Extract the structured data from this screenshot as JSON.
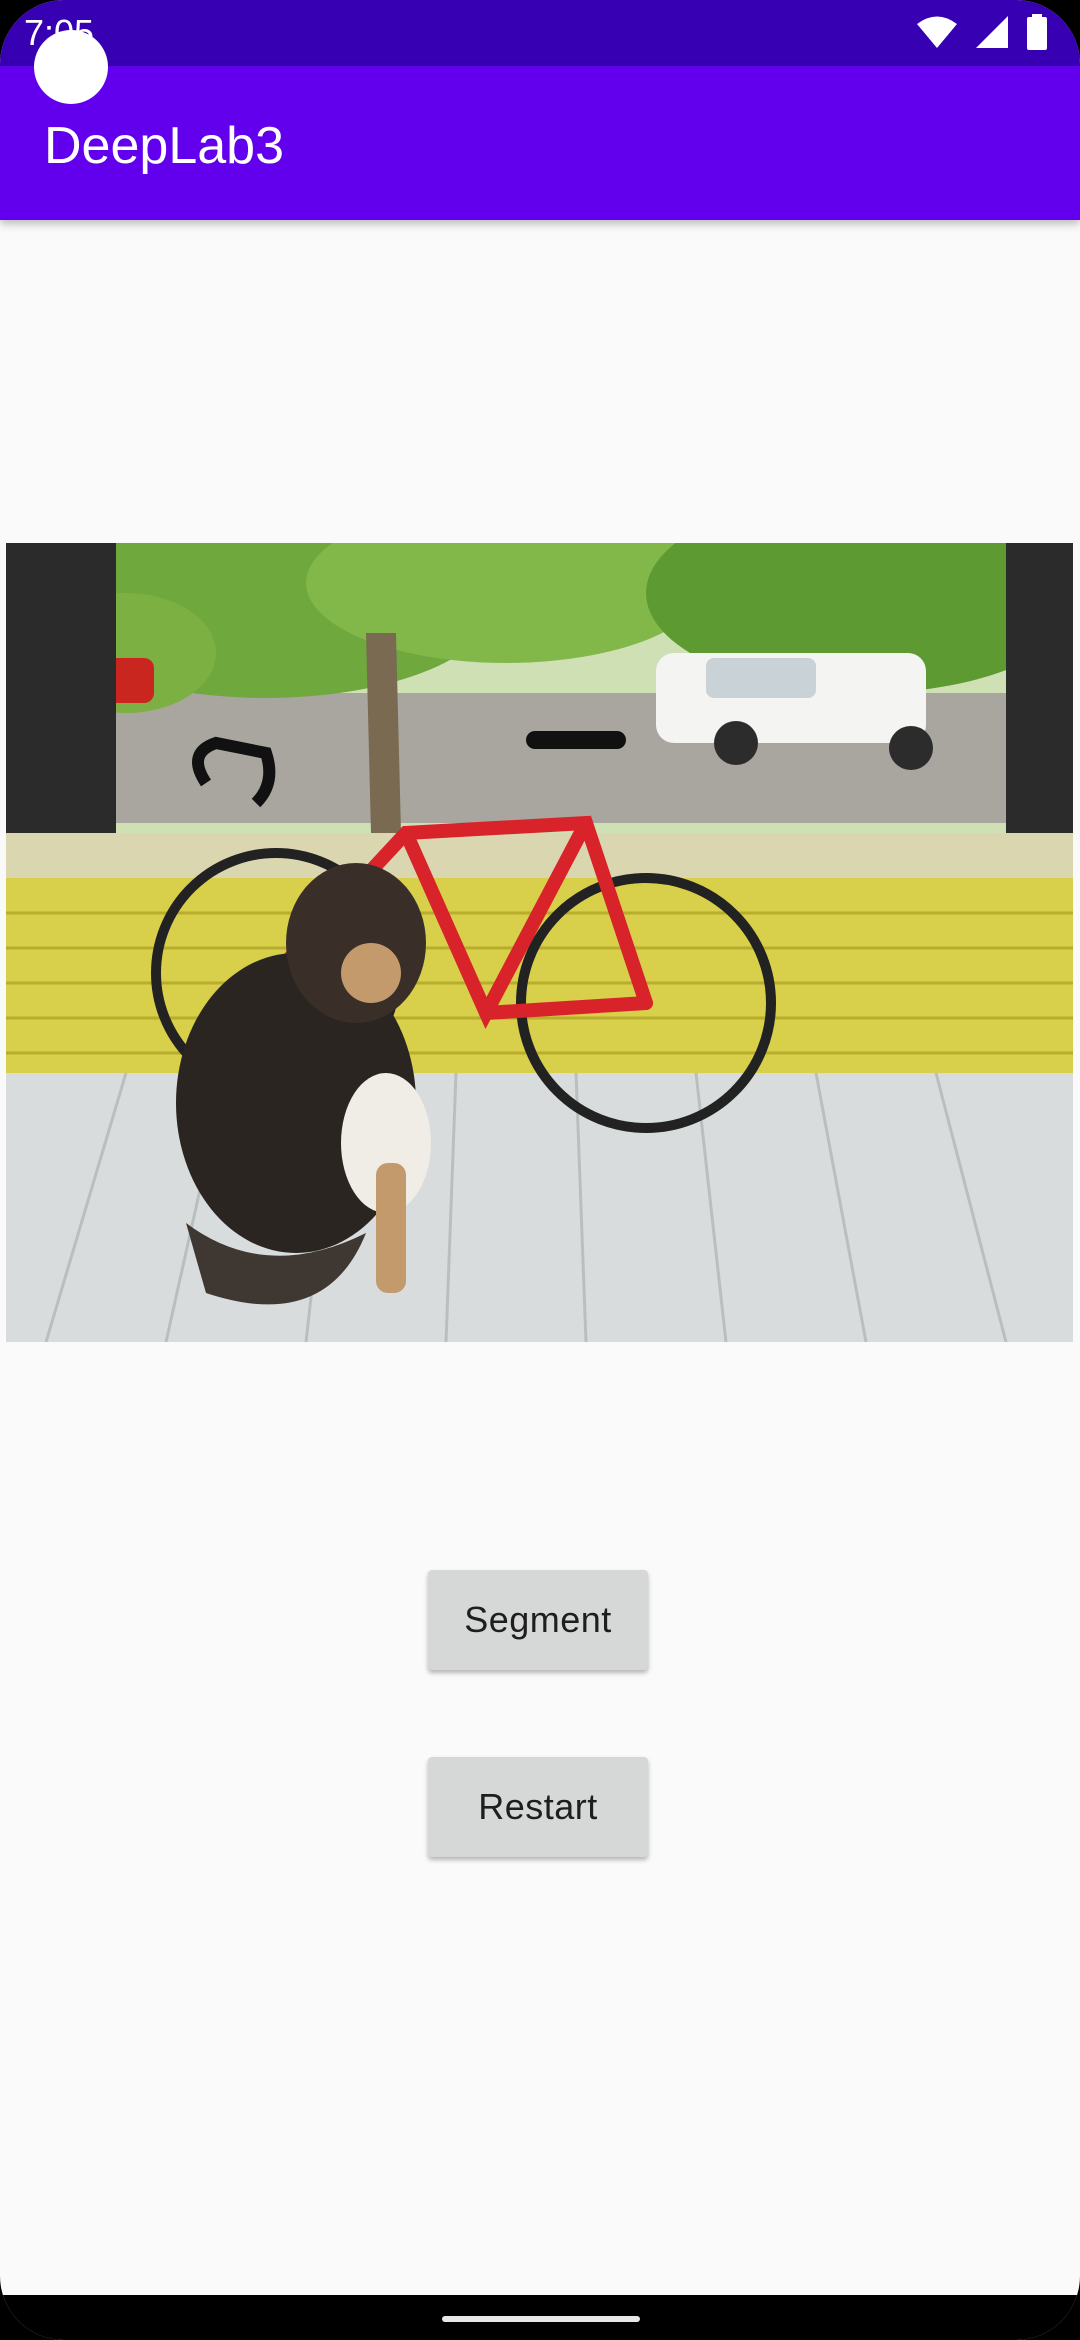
{
  "status_bar": {
    "time": "7:05",
    "icons": [
      "wifi-icon",
      "cellular-signal-icon",
      "battery-icon"
    ],
    "background": "#3700b3"
  },
  "app_bar": {
    "title": "DeepLab3",
    "background": "#6200ee"
  },
  "main": {
    "image": {
      "subject": "dog sitting on a porch beside a red road bicycle, white pickup truck on the street"
    },
    "segment_label": "Segment",
    "restart_label": "Restart"
  },
  "nav_bar": {
    "icons": [
      "home-gesture-handle"
    ]
  }
}
